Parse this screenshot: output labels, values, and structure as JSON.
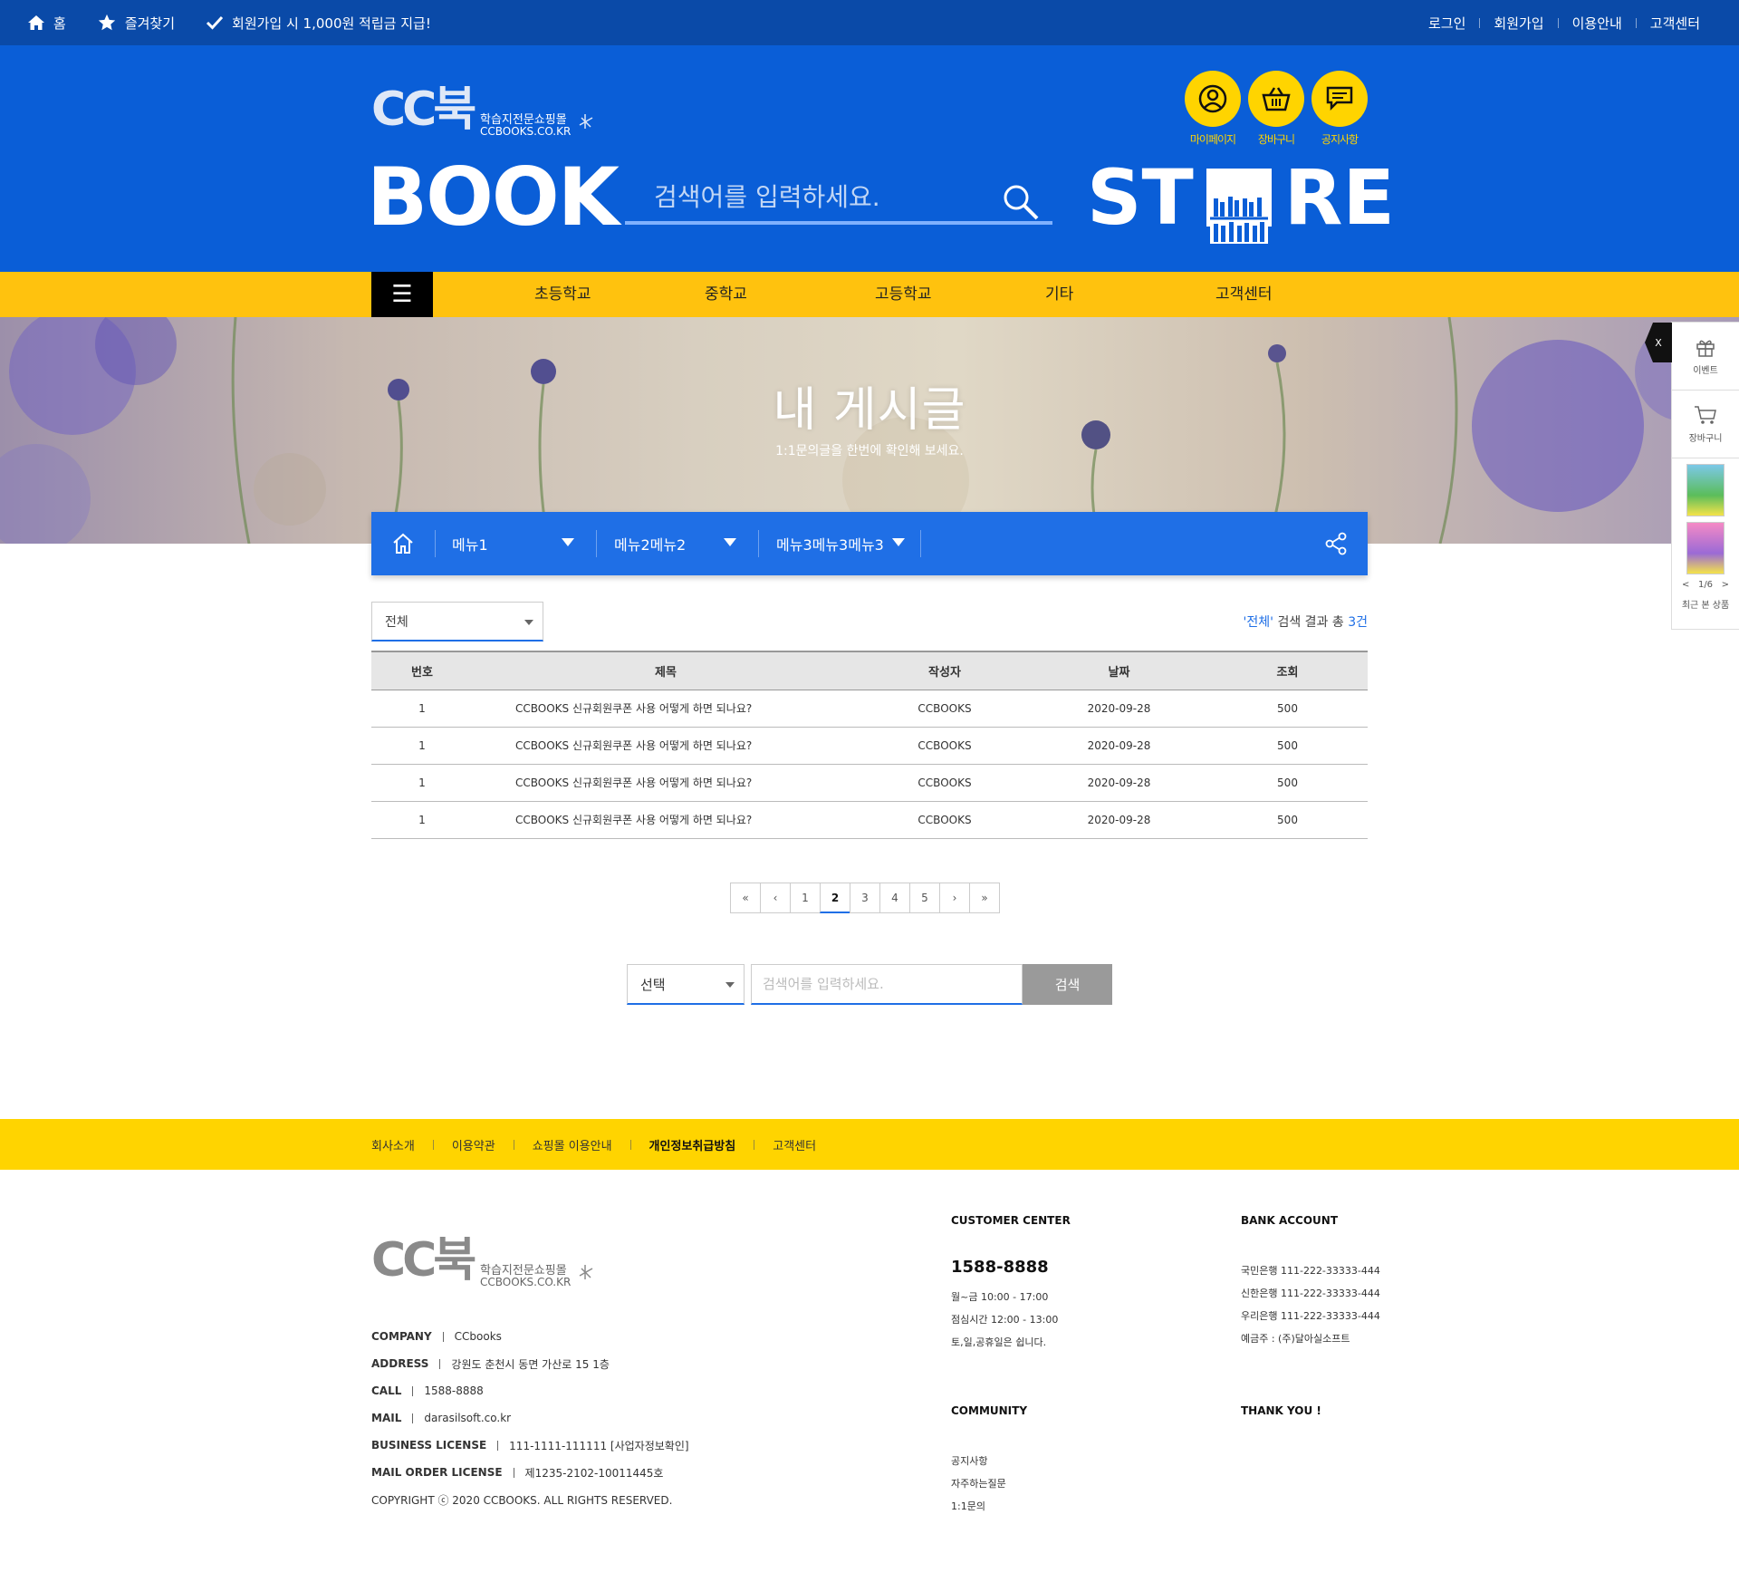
{
  "topbar": {
    "home": "홈",
    "favorite": "즐겨찾기",
    "promo": "회원가입 시 1,000원 적립금 지급!",
    "links": [
      "로그인",
      "회원가입",
      "이용안내",
      "고객센터"
    ]
  },
  "header": {
    "logo_text": "CC북",
    "logo_sub_ko": "학습지전문쇼핑몰",
    "logo_sub_en": "CCBOOKS.CO.KR",
    "book_word": "BOOK",
    "store_left": "ST",
    "store_right": "RE",
    "search_placeholder": "검색어를 입력하세요.",
    "circles": [
      {
        "label": "마이페이지",
        "icon": "user-icon"
      },
      {
        "label": "장바구니",
        "icon": "basket-icon"
      },
      {
        "label": "공지사항",
        "icon": "notice-chat-icon"
      }
    ]
  },
  "nav": {
    "menu_icon": "☰",
    "items": [
      "초등학교",
      "중학교",
      "고등학교",
      "기타",
      "고객센터"
    ]
  },
  "banner": {
    "title": "내 게시글",
    "subtitle": "1:1문의글을 한번에 확인해 보세요."
  },
  "location": {
    "menus": [
      "메뉴1",
      "메뉴2메뉴2",
      "메뉴3메뉴3메뉴3"
    ]
  },
  "filter": {
    "selected": "전체",
    "result_prefix": "'전체'",
    "result_mid": " 검색 결과 총 ",
    "result_count": "3건"
  },
  "table": {
    "headers": [
      "번호",
      "제목",
      "작성자",
      "날짜",
      "조회"
    ],
    "rows": [
      [
        "1",
        "CCBOOKS 신규회원쿠폰 사용 어떻게 하면 되나요?",
        "CCBOOKS",
        "2020-09-28",
        "500"
      ],
      [
        "1",
        "CCBOOKS 신규회원쿠폰 사용 어떻게 하면 되나요?",
        "CCBOOKS",
        "2020-09-28",
        "500"
      ],
      [
        "1",
        "CCBOOKS 신규회원쿠폰 사용 어떻게 하면 되나요?",
        "CCBOOKS",
        "2020-09-28",
        "500"
      ],
      [
        "1",
        "CCBOOKS 신규회원쿠폰 사용 어떻게 하면 되나요?",
        "CCBOOKS",
        "2020-09-28",
        "500"
      ]
    ]
  },
  "pager": {
    "first": "«",
    "prev": "‹",
    "pages": [
      "1",
      "2",
      "3",
      "4",
      "5"
    ],
    "current": "2",
    "next": "›",
    "last": "»"
  },
  "bottom_search": {
    "select": "선택",
    "placeholder": "검색어를 입력하세요.",
    "button": "검색"
  },
  "footer": {
    "links": [
      "회사소개",
      "이용약관",
      "쇼핑몰 이용안내",
      "개인정보취급방침",
      "고객센터"
    ],
    "company_info": [
      {
        "k": "COMPANY",
        "v": "CCbooks"
      },
      {
        "k": "ADDRESS",
        "v": "강원도 춘천시 동면 가산로 15 1층"
      },
      {
        "k": "CALL",
        "v": "1588-8888"
      },
      {
        "k": "MAIL",
        "v": "darasilsoft.co.kr"
      },
      {
        "k": "BUSINESS LICENSE",
        "v": "111-1111-111111 [사업자정보확인]"
      },
      {
        "k": "MAIL ORDER LICENSE",
        "v": "제1235-2102-10011445호"
      }
    ],
    "copyright": "COPYRIGHT ⓒ 2020 CCBOOKS. ALL RIGHTS RESERVED.",
    "customer_center": {
      "title": "CUSTOMER CENTER",
      "phone": "1588-8888",
      "lines": [
        "월~금 10:00 - 17:00",
        "점심시간 12:00 - 13:00",
        "토,일,공휴일은 쉽니다."
      ]
    },
    "bank": {
      "title": "BANK ACCOUNT",
      "lines": [
        "국민은행 111-222-33333-444",
        "신한은행 111-222-33333-444",
        "우리은행 111-222-33333-444",
        "예금주 : (주)달아실소프트"
      ]
    },
    "community": {
      "title": "COMMUNITY",
      "lines": [
        "공지사항",
        "자주하는질문",
        "1:1문의"
      ]
    },
    "thanks": "THANK YOU !"
  },
  "quick": {
    "close": "X",
    "event": "이벤트",
    "cart": "장바구니",
    "pagination": "1/6",
    "prev": "<",
    "next": ">",
    "recent": "최근 본 상품"
  },
  "colors": {
    "topbar": "#0a4aa8",
    "header": "#0a5ed7",
    "nav": "#ffc20e",
    "accent_blue": "#1f6fe6",
    "footer_bar": "#ffd400"
  }
}
